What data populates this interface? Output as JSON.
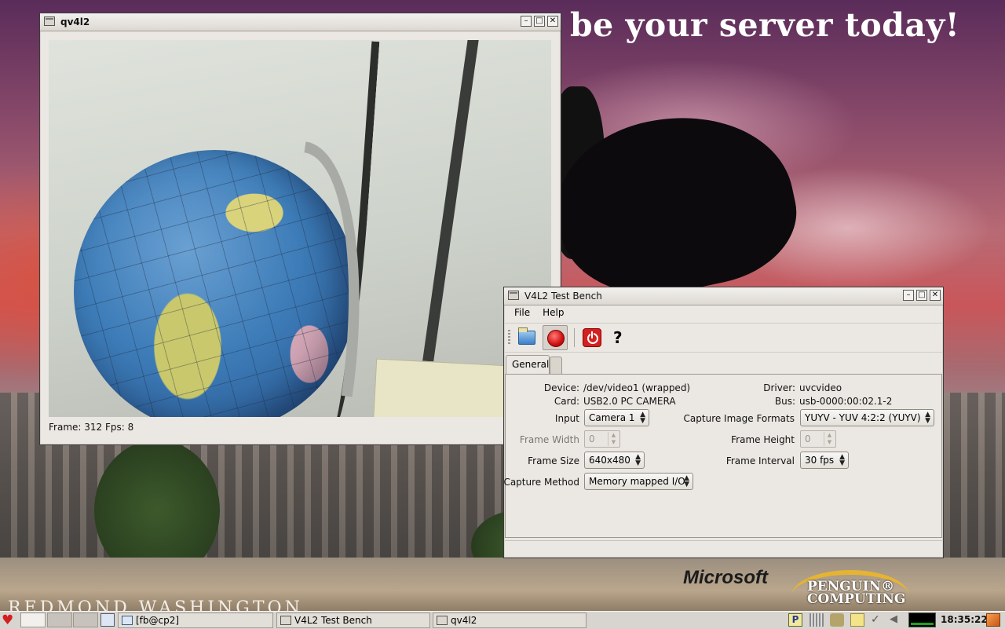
{
  "desktop": {
    "slogan": "be your server today!",
    "microsoft_text": "Microsoft",
    "penguin_computing_text": "PENGUIN® COMPUTING",
    "location_text": "REDMOND WASHINGTON"
  },
  "qv4l2_window": {
    "title": "qv4l2",
    "status": "Frame: 312 Fps: 8"
  },
  "testbench_window": {
    "title": "V4L2 Test Bench",
    "menu": {
      "file": "File",
      "help": "Help"
    },
    "toolbar": {
      "open_icon": "folder-open-icon",
      "capture_icon": "record-icon",
      "close_icon": "power-icon",
      "whats_this_icon": "whats-this-icon",
      "help_glyph": "?"
    },
    "tabs": [
      "General",
      ""
    ],
    "general": {
      "device_label": "Device:",
      "device_value": "/dev/video1 (wrapped)",
      "card_label": "Card:",
      "card_value": "USB2.0 PC CAMERA",
      "driver_label": "Driver:",
      "driver_value": "uvcvideo",
      "bus_label": "Bus:",
      "bus_value": "usb-0000:00:02.1-2",
      "input_label": "Input",
      "input_value": "Camera 1",
      "capture_formats_label": "Capture Image Formats",
      "capture_formats_value": "YUYV - YUV 4:2:2 (YUYV)",
      "frame_width_label": "Frame Width",
      "frame_width_value": "0",
      "frame_height_label": "Frame Height",
      "frame_height_value": "0",
      "frame_size_label": "Frame Size",
      "frame_size_value": "640x480",
      "frame_interval_label": "Frame Interval",
      "frame_interval_value": "30 fps",
      "capture_method_label": "Capture Method",
      "capture_method_value": "Memory mapped I/O"
    }
  },
  "taskbar": {
    "tasks": [
      {
        "label": "[fb@cp2]"
      },
      {
        "label": "V4L2 Test Bench"
      },
      {
        "label": "qv4l2"
      }
    ],
    "clock": "18:35:22",
    "tray_p": "P"
  }
}
